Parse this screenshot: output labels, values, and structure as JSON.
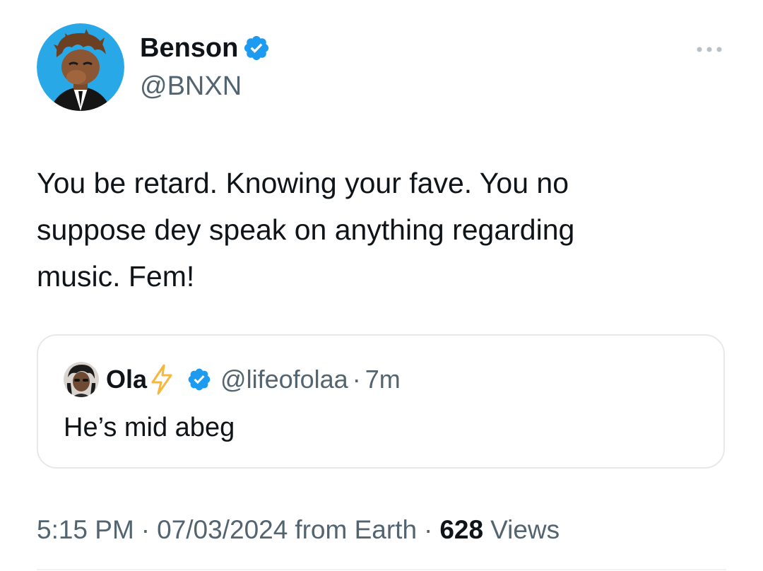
{
  "tweet": {
    "author": {
      "display_name": "Benson",
      "handle": "@BNXN",
      "verified": true,
      "avatar_icon": "cartoon-avatar-icon"
    },
    "text": "You be retard. Knowing your fave. You no\nsuppose dey speak on anything regarding\nmusic. Fem!",
    "quoted": {
      "display_name": "Ola",
      "emoji_icon": "lightning-bolt-icon",
      "verified": true,
      "handle": "@lifeofolaa",
      "separator": "·",
      "time_ago": "7m",
      "text": "He’s mid abeg"
    },
    "meta": {
      "time": "5:15 PM",
      "separator": "·",
      "date": "07/03/2024",
      "source": "from Earth",
      "views_count": "628",
      "views_label": "Views"
    }
  },
  "colors": {
    "verified_blue": "#1d9bf0",
    "secondary_text": "#536471",
    "primary_text": "#0f1419",
    "border": "#e6e9ec",
    "bolt_yellow": "#f6b73c",
    "avatar_bg": "#29a8e8"
  }
}
